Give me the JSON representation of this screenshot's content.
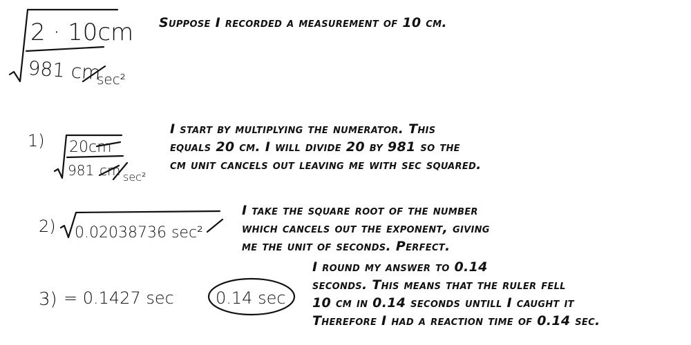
{
  "formula": {
    "numerator": "2 · 10cm",
    "denominator_value": "981 cm",
    "denominator_unit": "sec²"
  },
  "intro": "Suppose I recorded a measurement of 10 cm.",
  "steps": [
    {
      "label": "1)",
      "numerator": "20cm",
      "denominator_value": "981",
      "denominator_unit_cancelled": "cm",
      "denominator_unit": "sec²",
      "lines": [
        "I start by multiplying the numerator. This",
        "equals 20 cm. I will divide 20 by 981 so the",
        "cm unit cancels out leaving me with sec squared."
      ]
    },
    {
      "label": "2)",
      "expression": "0.02038736 sec²",
      "lines": [
        "I take the square root of the number",
        "which cancels out the exponent, giving",
        "me the unit of seconds. Perfect."
      ]
    },
    {
      "label": "3)",
      "expression": "= 0.1427 sec",
      "answer": "0.14 sec",
      "lines": [
        "I round my answer to 0.14",
        "seconds. This means that the ruler fell",
        "10 cm in 0.14 seconds untill I caught it",
        "Therefore I had a reaction time of 0.14 sec."
      ]
    }
  ]
}
